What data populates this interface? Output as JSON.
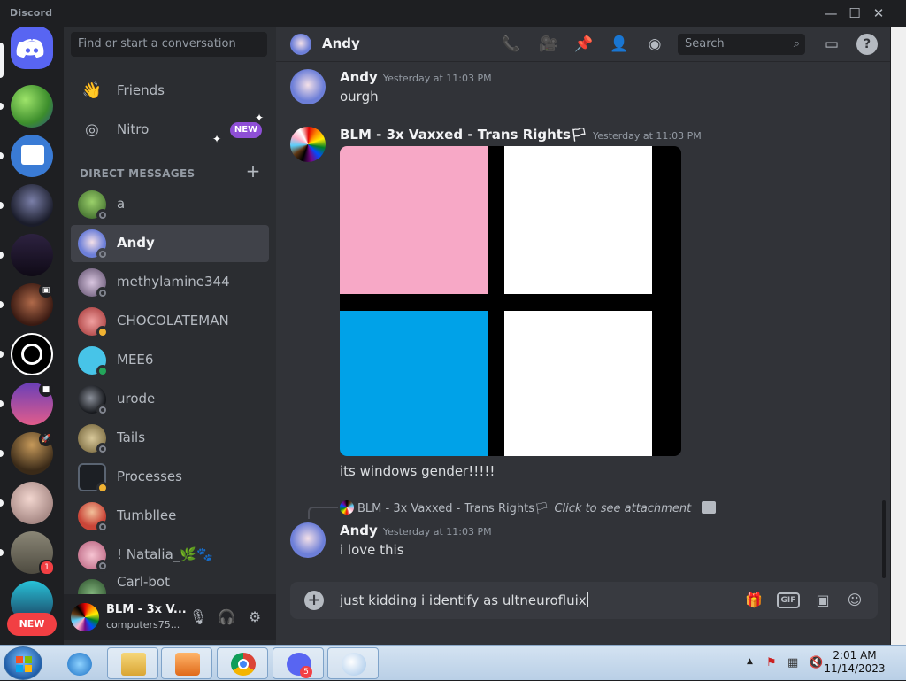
{
  "window": {
    "title": "Discord",
    "controls": [
      "—",
      "☐",
      "✕"
    ]
  },
  "servers": {
    "new_label": "NEW",
    "badge_count": "1"
  },
  "sidebar": {
    "search_placeholder": "Find or start a conversation",
    "friends_label": "Friends",
    "nitro_label": "Nitro",
    "nitro_badge": "NEW",
    "dm_heading": "DIRECT MESSAGES",
    "dms": [
      {
        "name": "a",
        "color": "#4e8d3a"
      },
      {
        "name": "Andy",
        "color": "#6d7fd8"
      },
      {
        "name": "methylamine344",
        "color": "#8c7a98"
      },
      {
        "name": "CHOCOLATEMAN",
        "color": "#c0534b"
      },
      {
        "name": "MEE6",
        "color": "#47c4e8"
      },
      {
        "name": "urode",
        "color": "#2c2f36"
      },
      {
        "name": "Tails",
        "color": "#b29c5e"
      },
      {
        "name": "Processes",
        "color": "#1c1f24"
      },
      {
        "name": "Tumbllee",
        "color": "#c94538"
      },
      {
        "name": "! Natalia_🌿🐾",
        "color": "#d68aa4"
      },
      {
        "name": "Carl-bot",
        "color": "#3c6d3e"
      }
    ]
  },
  "user": {
    "name": "BLM - 3x V...",
    "handle": "computers75..."
  },
  "channel": {
    "title": "Andy",
    "search_placeholder": "Search"
  },
  "messages": [
    {
      "author": "Andy",
      "timestamp": "Yesterday at 11:03 PM",
      "text": "ourgh"
    },
    {
      "author": "BLM - 3x Vaxxed - Trans Rights🏳",
      "timestamp": "Yesterday at 11:03 PM",
      "text": "its windows gender!!!!!"
    },
    {
      "author": "Andy",
      "timestamp": "Yesterday at 11:03 PM",
      "text": "i love this"
    }
  ],
  "reply": {
    "author": "BLM - 3x Vaxxed - Trans Rights🏳",
    "text": "Click to see attachment"
  },
  "composer": {
    "value": "just kidding i identify as ultneurofluix"
  },
  "taskbar": {
    "discord_badge": "5",
    "time": "2:01 AM",
    "date": "11/14/2023"
  }
}
